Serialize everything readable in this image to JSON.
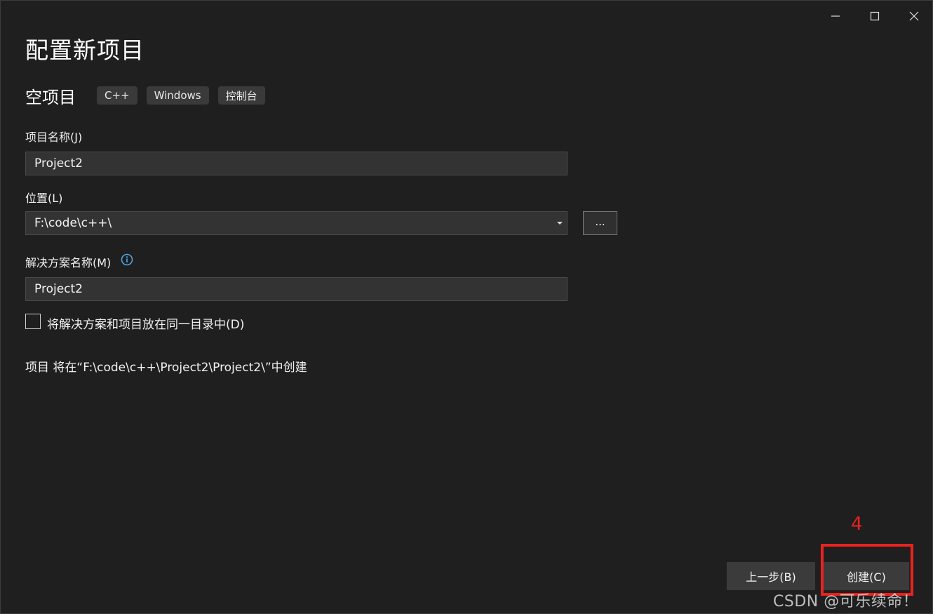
{
  "window": {
    "title": "配置新项目",
    "caption_buttons": [
      "minimize",
      "maximize",
      "close"
    ]
  },
  "template": {
    "name": "空项目",
    "tags": [
      "C++",
      "Windows",
      "控制台"
    ]
  },
  "form": {
    "project_name_label": "项目名称(J)",
    "project_name_value": "Project2",
    "location_label": "位置(L)",
    "location_value": "F:\\code\\c++\\",
    "browse_label": "...",
    "solution_name_label": "解决方案名称(M)",
    "solution_name_value": "Project2",
    "same_dir_label": "将解决方案和项目放在同一目录中(D)",
    "same_dir_checked": false,
    "path_note": "项目 将在“F:\\code\\c++\\Project2\\Project2\\”中创建"
  },
  "footer": {
    "back_label": "上一步(B)",
    "create_label": "创建(C)"
  },
  "annotation": {
    "step_number": "4",
    "highlight_color": "#e8231f"
  },
  "watermark": "CSDN @可乐续命！",
  "colors": {
    "background": "#1f1f1f",
    "field_bg": "#333333",
    "button_bg": "#3b3b3b",
    "info_icon": "#4fa9e8"
  }
}
